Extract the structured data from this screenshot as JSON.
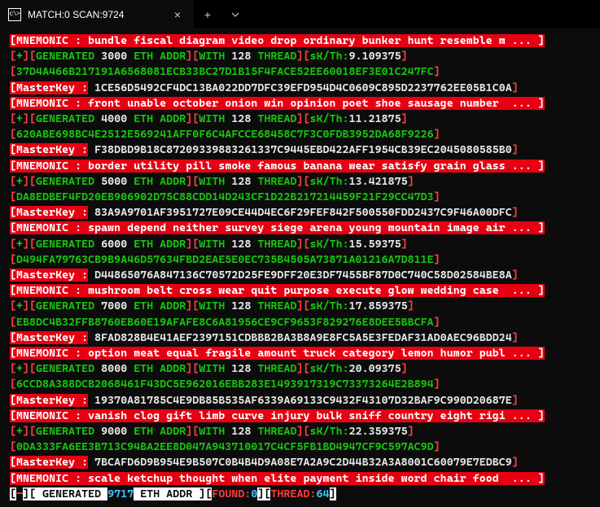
{
  "window": {
    "title": "MATCH:0 SCAN:9724",
    "close": "×",
    "plus": "+",
    "chevron": "⌄"
  },
  "lines": [
    [
      {
        "t": " ",
        "cls": ""
      },
      {
        "t": "[MNEMONIC : bundle fiscal diagram video drop ordinary bunker hunt resemble m ... ]",
        "cls": "bg-red"
      }
    ],
    [
      {
        "t": " [",
        "cls": "fg-red"
      },
      {
        "t": "+",
        "cls": "fg-green"
      },
      {
        "t": "][",
        "cls": "fg-red"
      },
      {
        "t": "GENERATED ",
        "cls": "fg-green"
      },
      {
        "t": "3000",
        "cls": "fg-white"
      },
      {
        "t": " ETH ADDR",
        "cls": "fg-green"
      },
      {
        "t": "][",
        "cls": "fg-red"
      },
      {
        "t": "WITH ",
        "cls": "fg-green"
      },
      {
        "t": "128",
        "cls": "fg-white"
      },
      {
        "t": " THREAD",
        "cls": "fg-green"
      },
      {
        "t": "][",
        "cls": "fg-red"
      },
      {
        "t": "sK/Th:",
        "cls": "fg-green"
      },
      {
        "t": "9.109375",
        "cls": "fg-white"
      },
      {
        "t": "]",
        "cls": "fg-red"
      }
    ],
    [
      {
        "t": " [",
        "cls": "fg-red"
      },
      {
        "t": "37D4A466B217191A6568081ECB33BC27D1B15F4FACE52EE60018EF3E01C247FC",
        "cls": "fg-green"
      },
      {
        "t": "]",
        "cls": "fg-red"
      }
    ],
    [
      {
        "t": " ",
        "cls": ""
      },
      {
        "t": "[MasterKey :",
        "cls": "bg-red"
      },
      {
        "t": " 1CE56D5492CF4DC13BA022DD7DFC39EFD954D4C0609C895D2237762EE05B1C0A",
        "cls": "fg-white"
      },
      {
        "t": "]",
        "cls": "fg-red"
      }
    ],
    [
      {
        "t": " ",
        "cls": ""
      },
      {
        "t": "[MNEMONIC : front unable october onion win opinion poet shoe sausage number  ... ]",
        "cls": "bg-red"
      }
    ],
    [
      {
        "t": " [",
        "cls": "fg-red"
      },
      {
        "t": "+",
        "cls": "fg-green"
      },
      {
        "t": "][",
        "cls": "fg-red"
      },
      {
        "t": "GENERATED ",
        "cls": "fg-green"
      },
      {
        "t": "4000",
        "cls": "fg-white"
      },
      {
        "t": " ETH ADDR",
        "cls": "fg-green"
      },
      {
        "t": "][",
        "cls": "fg-red"
      },
      {
        "t": "WITH ",
        "cls": "fg-green"
      },
      {
        "t": "128",
        "cls": "fg-white"
      },
      {
        "t": " THREAD",
        "cls": "fg-green"
      },
      {
        "t": "][",
        "cls": "fg-red"
      },
      {
        "t": "sK/Th:",
        "cls": "fg-green"
      },
      {
        "t": "11.21875",
        "cls": "fg-white"
      },
      {
        "t": "]",
        "cls": "fg-red"
      }
    ],
    [
      {
        "t": " [",
        "cls": "fg-red"
      },
      {
        "t": "620ABE698BC4E2512E569241AFF0F6C4AFCCE68458C7F3C0FDB3952DA68F9226",
        "cls": "fg-green"
      },
      {
        "t": "]",
        "cls": "fg-red"
      }
    ],
    [
      {
        "t": " ",
        "cls": ""
      },
      {
        "t": "[MasterKey :",
        "cls": "bg-red"
      },
      {
        "t": " F38DBD9B18C87209339883261337C9445EBD422AFF1954CB39EC2045080585B0",
        "cls": "fg-white"
      },
      {
        "t": "]",
        "cls": "fg-red"
      }
    ],
    [
      {
        "t": " ",
        "cls": ""
      },
      {
        "t": "[MNEMONIC : border utility pill smoke famous banana wear satisfy grain glass ... ]",
        "cls": "bg-red"
      }
    ],
    [
      {
        "t": " [",
        "cls": "fg-red"
      },
      {
        "t": "+",
        "cls": "fg-green"
      },
      {
        "t": "][",
        "cls": "fg-red"
      },
      {
        "t": "GENERATED ",
        "cls": "fg-green"
      },
      {
        "t": "5000",
        "cls": "fg-white"
      },
      {
        "t": " ETH ADDR",
        "cls": "fg-green"
      },
      {
        "t": "][",
        "cls": "fg-red"
      },
      {
        "t": "WITH ",
        "cls": "fg-green"
      },
      {
        "t": "128",
        "cls": "fg-white"
      },
      {
        "t": " THREAD",
        "cls": "fg-green"
      },
      {
        "t": "][",
        "cls": "fg-red"
      },
      {
        "t": "sK/Th:",
        "cls": "fg-green"
      },
      {
        "t": "13.421875",
        "cls": "fg-white"
      },
      {
        "t": "]",
        "cls": "fg-red"
      }
    ],
    [
      {
        "t": " [",
        "cls": "fg-red"
      },
      {
        "t": "DA8EDBEF4FD20EB906902D75C88CDD14D243CF1D22B217214459F21F29CC47D3",
        "cls": "fg-green"
      },
      {
        "t": "]",
        "cls": "fg-red"
      }
    ],
    [
      {
        "t": " ",
        "cls": ""
      },
      {
        "t": "[MasterKey :",
        "cls": "bg-red"
      },
      {
        "t": " 83A9A9701AF3951727E09CE44D4EC6F29FEF842F500550FDD2437C9F46A00DFC",
        "cls": "fg-white"
      },
      {
        "t": "]",
        "cls": "fg-red"
      }
    ],
    [
      {
        "t": " ",
        "cls": ""
      },
      {
        "t": "[MNEMONIC : spawn depend neither survey siege arena young mountain image air ... ]",
        "cls": "bg-red"
      }
    ],
    [
      {
        "t": " [",
        "cls": "fg-red"
      },
      {
        "t": "+",
        "cls": "fg-green"
      },
      {
        "t": "][",
        "cls": "fg-red"
      },
      {
        "t": "GENERATED ",
        "cls": "fg-green"
      },
      {
        "t": "6000",
        "cls": "fg-white"
      },
      {
        "t": " ETH ADDR",
        "cls": "fg-green"
      },
      {
        "t": "][",
        "cls": "fg-red"
      },
      {
        "t": "WITH ",
        "cls": "fg-green"
      },
      {
        "t": "128",
        "cls": "fg-white"
      },
      {
        "t": " THREAD",
        "cls": "fg-green"
      },
      {
        "t": "][",
        "cls": "fg-red"
      },
      {
        "t": "sK/Th:",
        "cls": "fg-green"
      },
      {
        "t": "15.59375",
        "cls": "fg-white"
      },
      {
        "t": "]",
        "cls": "fg-red"
      }
    ],
    [
      {
        "t": " [",
        "cls": "fg-red"
      },
      {
        "t": "D494FA79763CB9B9A46D57634FBD2EAE5E0EC735B4505A73871A01216A7D811E",
        "cls": "fg-green"
      },
      {
        "t": "]",
        "cls": "fg-red"
      }
    ],
    [
      {
        "t": " ",
        "cls": ""
      },
      {
        "t": "[MasterKey :",
        "cls": "bg-red"
      },
      {
        "t": " D44865076A847136C70572D25FE9DFF20E3DF7455BF87D0C740C58D02584BE8A",
        "cls": "fg-white"
      },
      {
        "t": "]",
        "cls": "fg-red"
      }
    ],
    [
      {
        "t": " ",
        "cls": ""
      },
      {
        "t": "[MNEMONIC : mushroom belt cross wear quit purpose execute glow wedding case  ... ]",
        "cls": "bg-red"
      }
    ],
    [
      {
        "t": " [",
        "cls": "fg-red"
      },
      {
        "t": "+",
        "cls": "fg-green"
      },
      {
        "t": "][",
        "cls": "fg-red"
      },
      {
        "t": "GENERATED ",
        "cls": "fg-green"
      },
      {
        "t": "7000",
        "cls": "fg-white"
      },
      {
        "t": " ETH ADDR",
        "cls": "fg-green"
      },
      {
        "t": "][",
        "cls": "fg-red"
      },
      {
        "t": "WITH ",
        "cls": "fg-green"
      },
      {
        "t": "128",
        "cls": "fg-white"
      },
      {
        "t": " THREAD",
        "cls": "fg-green"
      },
      {
        "t": "][",
        "cls": "fg-red"
      },
      {
        "t": "sK/Th:",
        "cls": "fg-green"
      },
      {
        "t": "17.859375",
        "cls": "fg-white"
      },
      {
        "t": "]",
        "cls": "fg-red"
      }
    ],
    [
      {
        "t": " [",
        "cls": "fg-red"
      },
      {
        "t": "EB8DC4B32FFB8760EB60E19AFAFE8C6A81956CE9CF9653F829276E8DEE5BBCFA",
        "cls": "fg-green"
      },
      {
        "t": "]",
        "cls": "fg-red"
      }
    ],
    [
      {
        "t": " ",
        "cls": ""
      },
      {
        "t": "[MasterKey :",
        "cls": "bg-red"
      },
      {
        "t": " 8FAD828B4E41AEF2397151CDBBB2BA3B8A9E8FC5A5E3FEDAF31AD0AEC96BDD24",
        "cls": "fg-white"
      },
      {
        "t": "]",
        "cls": "fg-red"
      }
    ],
    [
      {
        "t": " ",
        "cls": ""
      },
      {
        "t": "[MNEMONIC : option meat equal fragile amount truck category lemon humor publ ... ]",
        "cls": "bg-red"
      }
    ],
    [
      {
        "t": " [",
        "cls": "fg-red"
      },
      {
        "t": "+",
        "cls": "fg-green"
      },
      {
        "t": "][",
        "cls": "fg-red"
      },
      {
        "t": "GENERATED ",
        "cls": "fg-green"
      },
      {
        "t": "8000",
        "cls": "fg-white"
      },
      {
        "t": " ETH ADDR",
        "cls": "fg-green"
      },
      {
        "t": "][",
        "cls": "fg-red"
      },
      {
        "t": "WITH ",
        "cls": "fg-green"
      },
      {
        "t": "128",
        "cls": "fg-white"
      },
      {
        "t": " THREAD",
        "cls": "fg-green"
      },
      {
        "t": "][",
        "cls": "fg-red"
      },
      {
        "t": "sK/Th:",
        "cls": "fg-green"
      },
      {
        "t": "20.09375",
        "cls": "fg-white"
      },
      {
        "t": "]",
        "cls": "fg-red"
      }
    ],
    [
      {
        "t": " [",
        "cls": "fg-red"
      },
      {
        "t": "6CCD8A388DCB2068461F43DC5E962016EBB283E1493917319C73373264E2B894",
        "cls": "fg-green"
      },
      {
        "t": "]",
        "cls": "fg-red"
      }
    ],
    [
      {
        "t": " ",
        "cls": ""
      },
      {
        "t": "[MasterKey :",
        "cls": "bg-red"
      },
      {
        "t": " 19370A81785C4E9DB85B535AF6339A69133C9432F43107D32BAF9C990D20687E",
        "cls": "fg-white"
      },
      {
        "t": "]",
        "cls": "fg-red"
      }
    ],
    [
      {
        "t": " ",
        "cls": ""
      },
      {
        "t": "[MNEMONIC : vanish clog gift limb curve injury bulk sniff country eight rigi ... ]",
        "cls": "bg-red"
      }
    ],
    [
      {
        "t": " [",
        "cls": "fg-red"
      },
      {
        "t": "+",
        "cls": "fg-green"
      },
      {
        "t": "][",
        "cls": "fg-red"
      },
      {
        "t": "GENERATED ",
        "cls": "fg-green"
      },
      {
        "t": "9000",
        "cls": "fg-white"
      },
      {
        "t": " ETH ADDR",
        "cls": "fg-green"
      },
      {
        "t": "][",
        "cls": "fg-red"
      },
      {
        "t": "WITH ",
        "cls": "fg-green"
      },
      {
        "t": "128",
        "cls": "fg-white"
      },
      {
        "t": " THREAD",
        "cls": "fg-green"
      },
      {
        "t": "][",
        "cls": "fg-red"
      },
      {
        "t": "sK/Th:",
        "cls": "fg-green"
      },
      {
        "t": "22.359375",
        "cls": "fg-white"
      },
      {
        "t": "]",
        "cls": "fg-red"
      }
    ],
    [
      {
        "t": " [",
        "cls": "fg-red"
      },
      {
        "t": "0DA333FA6EE3B713C94BA2EE8D047A943710017C4CF5FB1BD4947CF9C597AC9D",
        "cls": "fg-green"
      },
      {
        "t": "]",
        "cls": "fg-red"
      }
    ],
    [
      {
        "t": " ",
        "cls": ""
      },
      {
        "t": "[MasterKey :",
        "cls": "bg-red"
      },
      {
        "t": " 7BCAFD6D9B954E9B507C0B4B4D9A08E7A2A9C2D44B32A3A8001C60079E7EDBC9",
        "cls": "fg-white"
      },
      {
        "t": "]",
        "cls": "fg-red"
      }
    ],
    [
      {
        "t": " ",
        "cls": ""
      },
      {
        "t": "[MNEMONIC : scale ketchup thought when elite payment inside word chair food  ... ]",
        "cls": "bg-red"
      }
    ],
    [
      {
        "t": " ",
        "cls": ""
      },
      {
        "t": "[",
        "cls": "bg-white"
      },
      {
        "t": "─",
        "cls": "fg-red"
      },
      {
        "t": "][ GENERATED ",
        "cls": "bg-white"
      },
      {
        "t": "9717",
        "cls": "fg-cyan"
      },
      {
        "t": " ETH ADDR ][",
        "cls": "bg-white"
      },
      {
        "t": "FOUND:",
        "cls": "fg-red"
      },
      {
        "t": "0",
        "cls": "fg-cyan"
      },
      {
        "t": "][",
        "cls": "bg-white"
      },
      {
        "t": "THREAD:",
        "cls": "fg-red"
      },
      {
        "t": "64",
        "cls": "fg-cyan"
      },
      {
        "t": "]",
        "cls": "bg-white"
      }
    ]
  ]
}
